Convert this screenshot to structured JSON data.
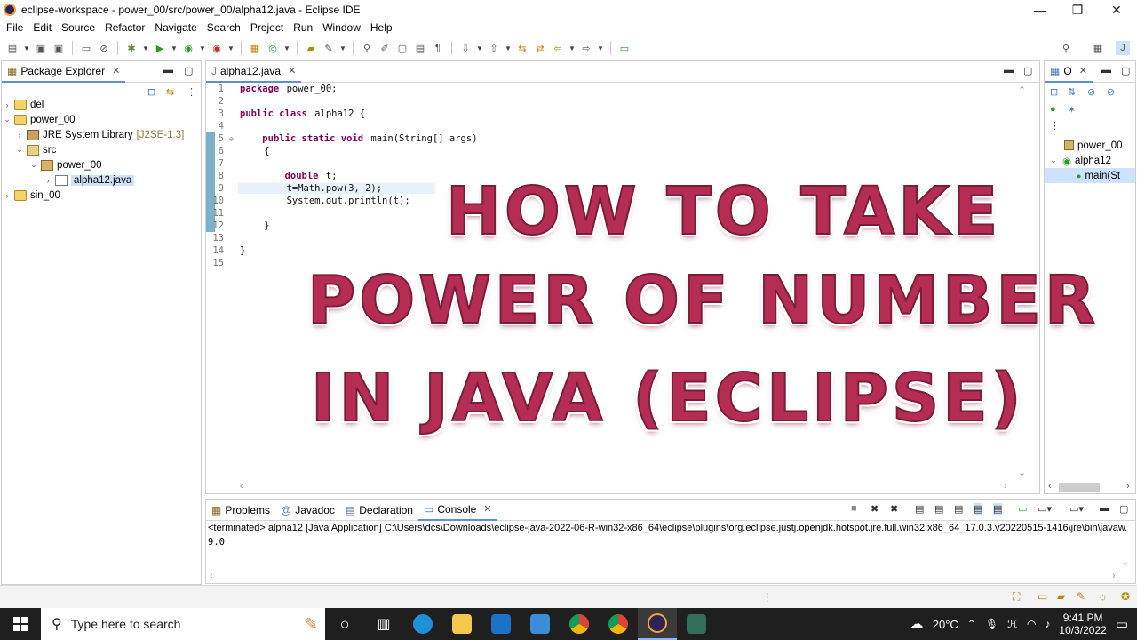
{
  "window": {
    "title": "eclipse-workspace - power_00/src/power_00/alpha12.java - Eclipse IDE",
    "minimize": "—",
    "maximize": "❐",
    "close": "✕"
  },
  "menu": [
    "File",
    "Edit",
    "Source",
    "Refactor",
    "Navigate",
    "Search",
    "Project",
    "Run",
    "Window",
    "Help"
  ],
  "package_explorer": {
    "tab_label": "Package Explorer",
    "items": [
      {
        "label": "del",
        "suffix": ""
      },
      {
        "label": "power_00",
        "suffix": ""
      },
      {
        "label": "JRE System Library",
        "suffix": "[J2SE-1.3]"
      },
      {
        "label": "src",
        "suffix": ""
      },
      {
        "label": "power_00",
        "suffix": ""
      },
      {
        "label": "alpha12.java",
        "suffix": ""
      },
      {
        "label": "sin_00",
        "suffix": ""
      }
    ]
  },
  "editor": {
    "tab_label": "alpha12.java",
    "lines": [
      {
        "n": "1",
        "pre": "",
        "kw": "package",
        "text": " power_00;"
      },
      {
        "n": "2",
        "pre": "",
        "kw": "",
        "text": ""
      },
      {
        "n": "3",
        "pre": "",
        "kw": "public class",
        "text": " alpha12 {"
      },
      {
        "n": "4",
        "pre": "",
        "kw": "",
        "text": ""
      },
      {
        "n": "5",
        "pre": "    ",
        "kw": "public static void",
        "text": " main(String[] args)"
      },
      {
        "n": "6",
        "pre": "    ",
        "kw": "",
        "text": "{"
      },
      {
        "n": "7",
        "pre": "",
        "kw": "",
        "text": ""
      },
      {
        "n": "8",
        "pre": "        ",
        "kw": "double",
        "text": " t;"
      },
      {
        "n": "9",
        "pre": "        ",
        "kw": "",
        "text": "t=Math.pow(3, 2);"
      },
      {
        "n": "10",
        "pre": "        ",
        "kw": "",
        "text": "System.out.println(t);"
      },
      {
        "n": "11",
        "pre": "",
        "kw": "",
        "text": ""
      },
      {
        "n": "12",
        "pre": "    ",
        "kw": "",
        "text": "}"
      },
      {
        "n": "13",
        "pre": "",
        "kw": "",
        "text": ""
      },
      {
        "n": "14",
        "pre": "",
        "kw": "",
        "text": "}"
      },
      {
        "n": "15",
        "pre": "",
        "kw": "",
        "text": ""
      }
    ]
  },
  "overlay": {
    "line1": "HOW TO TAKE",
    "line2": "POWER OF NUMBER",
    "line3": "IN JAVA  (ECLIPSE)"
  },
  "outline": {
    "tab_label": "O",
    "items": [
      "power_00",
      "alpha12",
      "main(St"
    ]
  },
  "bottom_panel": {
    "tabs": [
      "Problems",
      "Javadoc",
      "Declaration",
      "Console"
    ],
    "console_header": "<terminated> alpha12 [Java Application] C:\\Users\\dcs\\Downloads\\eclipse-java-2022-06-R-win32-x86_64\\eclipse\\plugins\\org.eclipse.justj.openjdk.hotspot.jre.full.win32.x86_64_17.0.3.v20220515-1416\\jre\\bin\\javaw.",
    "output": "9.0"
  },
  "taskbar": {
    "search_placeholder": "Type here to search",
    "weather": "20°C",
    "time": "9:41 PM",
    "date": "10/3/2022"
  },
  "colors": {
    "keyword": "#7f0055",
    "overlay_text": "#b52d55",
    "taskbar": "#1f1f1f"
  }
}
